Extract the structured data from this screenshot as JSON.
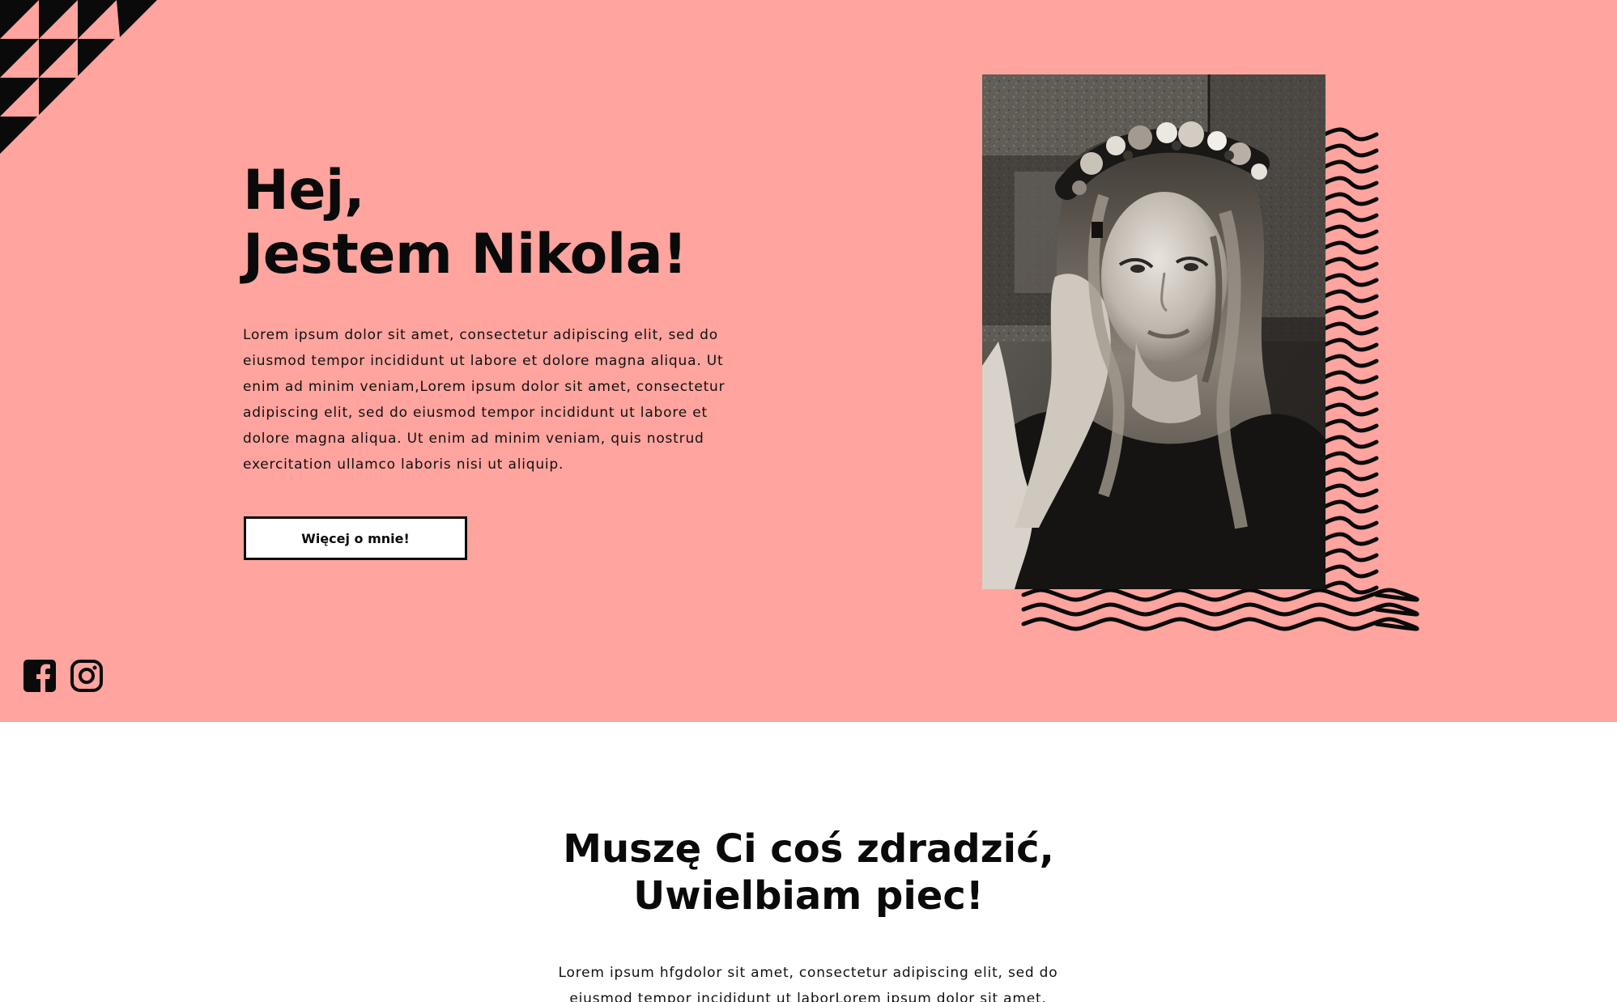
{
  "hero": {
    "background_color": "#ffa49e",
    "title_line1": "Hej,",
    "title_line2": "Jestem Nikola!",
    "paragraph": "Lorem ipsum dolor sit amet, consectetur adipiscing elit, sed do eiusmod tempor incididunt ut labore et dolore magna aliqua. Ut enim ad minim veniam,Lorem ipsum dolor sit amet, consectetur adipiscing elit, sed do eiusmod tempor incididunt ut labore et dolore magna aliqua. Ut enim ad minim veniam, quis nostrud exercitation ullamco laboris nisi ut aliquip.",
    "button_label": "Więcej o mnie!",
    "photo": "portrait-photo-woman-flower-crown",
    "decor": [
      "corner-triangle-pattern",
      "wavy-lines-pattern"
    ]
  },
  "social": {
    "icons": [
      "facebook-icon",
      "instagram-icon"
    ]
  },
  "section2": {
    "title_line1": "Muszę Ci coś zdradzić,",
    "title_line2": "Uwielbiam piec!",
    "paragraph": "Lorem ipsum hfgdolor sit amet, consectetur adipiscing elit, sed do eiusmod tempor incididunt ut laborLorem ipsum dolor sit amet,"
  }
}
